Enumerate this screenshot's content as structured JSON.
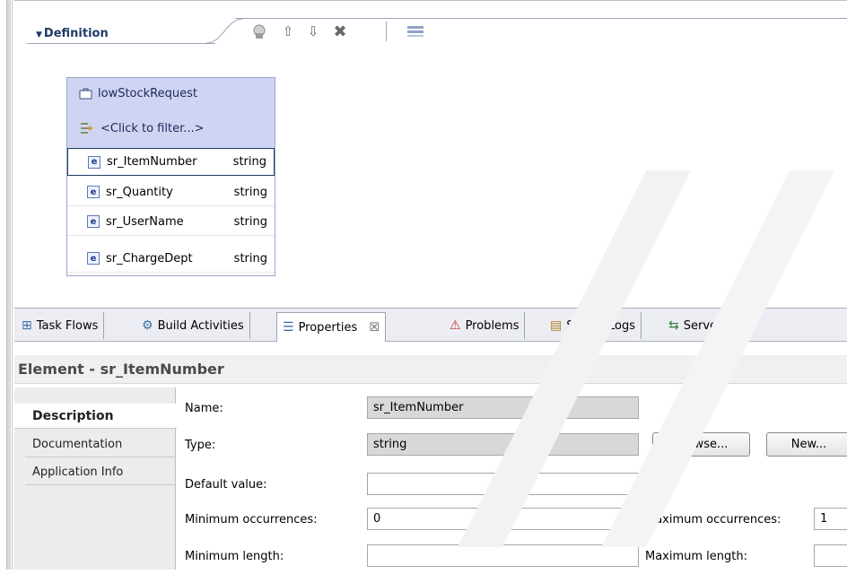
{
  "definition": {
    "title": "Definition",
    "toolbar_icons": [
      "add-icon",
      "move-up-icon",
      "move-down-icon",
      "delete-icon",
      "layout-icon"
    ]
  },
  "business_object": {
    "name": "lowStockRequest",
    "filter": "<Click to filter...>",
    "fields": [
      {
        "name": "sr_ItemNumber",
        "type": "string"
      },
      {
        "name": "sr_Quantity",
        "type": "string"
      },
      {
        "name": "sr_UserName",
        "type": "string"
      },
      {
        "name": "sr_ChargeDept",
        "type": "string"
      }
    ]
  },
  "tabs": [
    {
      "label": "Task Flows",
      "icon": "task-flows-icon"
    },
    {
      "label": "Build Activities",
      "icon": "build-activities-icon"
    },
    {
      "label": "Properties",
      "icon": "properties-icon",
      "close": "☒"
    },
    {
      "label": "Problems",
      "icon": "problems-icon"
    },
    {
      "label": "Server Logs",
      "icon": "server-logs-icon"
    },
    {
      "label": "Servers",
      "icon": "servers-icon"
    }
  ],
  "properties": {
    "title": "Element - sr_ItemNumber",
    "side_tabs": [
      "Description",
      "Documentation",
      "Application Info"
    ],
    "form": {
      "name_label": "Name:",
      "name_value": "sr_ItemNumber",
      "type_label": "Type:",
      "type_value": "string",
      "browse_label": "Browse...",
      "new_label": "New...",
      "default_label": "Default value:",
      "default_value": "",
      "min_occ_label": "Minimum occurrences:",
      "min_occ_value": "0",
      "max_occ_label": "Maximum occurrences:",
      "max_occ_value": "1",
      "min_len_label": "Minimum length:",
      "min_len_value": "",
      "max_len_label": "Maximum length:",
      "max_len_value": ""
    }
  }
}
